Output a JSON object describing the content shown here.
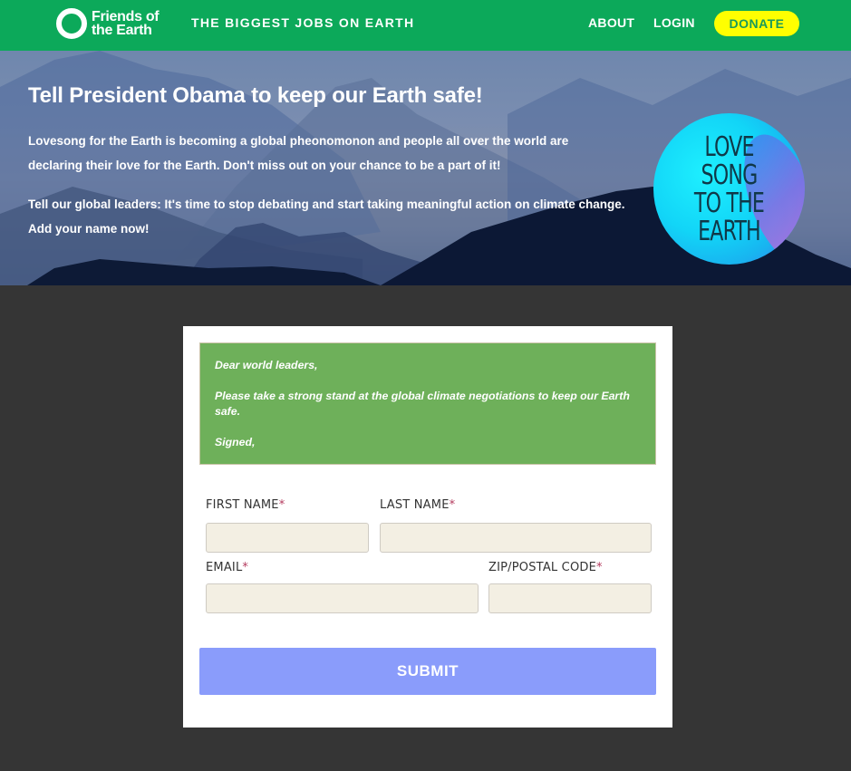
{
  "header": {
    "logo_line1": "Friends of",
    "logo_line2": "the Earth",
    "tagline": "THE BIGGEST JOBS ON EARTH",
    "nav": {
      "about": "ABOUT",
      "login": "LOGIN",
      "donate": "DONATE"
    },
    "colors": {
      "bar": "#0ca95a",
      "donate_bg": "#ffff00"
    }
  },
  "hero": {
    "title": "Tell President Obama to keep our Earth safe!",
    "paragraph1": "Lovesong for the Earth is becoming a global pheonomonon and people all over the world are declaring their love for the Earth. Don't miss out on your chance to be a part of it!",
    "paragraph2": "Tell our global leaders: It's time to stop debating and start taking meaningful action on climate change. Add your name now!",
    "badge_lines": [
      "LOVE",
      "SONG",
      "TO THE",
      "EARTH"
    ]
  },
  "letter": {
    "salutation": "Dear world leaders,",
    "body": "Please take a strong stand at the global climate negotiations to keep our Earth safe.",
    "closing": "Signed,"
  },
  "form": {
    "first_name_label": "FIRST NAME",
    "last_name_label": "LAST NAME",
    "email_label": "EMAIL",
    "zip_label": "ZIP/POSTAL CODE",
    "required_marker": "*",
    "first_name_value": "",
    "last_name_value": "",
    "email_value": "",
    "zip_value": "",
    "submit_label": "SUBMIT",
    "colors": {
      "letter_bg": "#6eb05a",
      "input_bg": "#f3efe3",
      "submit_bg": "#8a9cfb",
      "required": "#b43b5e"
    }
  }
}
